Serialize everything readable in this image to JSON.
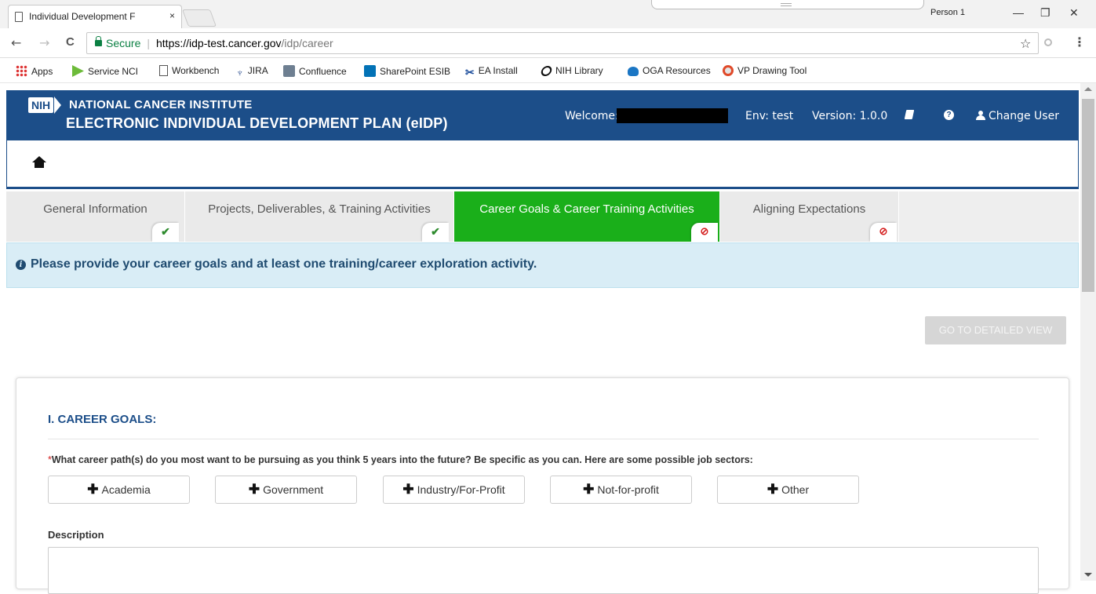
{
  "browser": {
    "tab_title": "Individual Development F",
    "tab_close": "×",
    "profile": "Person 1",
    "minimize": "—",
    "restore": "❐",
    "close": "✕",
    "back": "←",
    "forward": "→",
    "reload": "C",
    "secure_label": "Secure",
    "url_host": "https://idp-test.cancer.gov",
    "url_path": "/idp/career",
    "star": "☆",
    "menu": "⋮"
  },
  "bookmarks": [
    {
      "label": "Apps",
      "icon": "apps-icon"
    },
    {
      "label": "Service NCI",
      "icon": "arrow-icon"
    },
    {
      "label": "Workbench",
      "icon": "document-icon"
    },
    {
      "label": "JIRA",
      "icon": "jira-icon"
    },
    {
      "label": "Confluence",
      "icon": "confluence-icon"
    },
    {
      "label": "SharePoint ESIB",
      "icon": "sharepoint-icon"
    },
    {
      "label": "EA Install",
      "icon": "ea-icon"
    },
    {
      "label": "NIH Library",
      "icon": "nih-library-icon"
    },
    {
      "label": "OGA Resources",
      "icon": "oga-icon"
    },
    {
      "label": "VP Drawing Tool",
      "icon": "vp-icon"
    }
  ],
  "header": {
    "logo_text": "NIH",
    "institute": "NATIONAL CANCER INSTITUTE",
    "app_title": "ELECTRONIC INDIVIDUAL DEVELOPMENT PLAN (eIDP)",
    "welcome": "Welcome:",
    "env": "Env: test",
    "version": "Version: 1.0.0",
    "help_glyph": "?",
    "change_user": "Change User"
  },
  "steps": [
    {
      "label": "General Information",
      "status": "complete",
      "glyph": "✔"
    },
    {
      "label": "Projects, Deliverables, & Training Activities",
      "status": "complete",
      "glyph": "✔"
    },
    {
      "label": "Career Goals & Career Training Activities",
      "status": "incomplete",
      "glyph": "⊘",
      "active": true
    },
    {
      "label": "Aligning Expectations",
      "status": "incomplete",
      "glyph": "⊘"
    }
  ],
  "alert": {
    "icon_glyph": "i",
    "text": "Please provide your career goals and at least one training/career exploration activity."
  },
  "detailed_view_label": "GO TO DETAILED VIEW",
  "career_goals": {
    "title": "I. CAREER GOALS:",
    "required_mark": "*",
    "question": "What career path(s) do you most want to be pursuing as you think 5 years into the future? Be specific as you can. Here are some possible job sectors:",
    "plus_glyph": "✚",
    "sectors": [
      "Academia",
      "Government",
      "Industry/For-Profit",
      "Not-for-profit",
      "Other"
    ],
    "description_label": "Description"
  },
  "colors": {
    "header_blue": "#1c4e89",
    "active_step_green": "#1aaf1a",
    "alert_bg": "#d9edf6",
    "required_red": "#d41c1c"
  }
}
